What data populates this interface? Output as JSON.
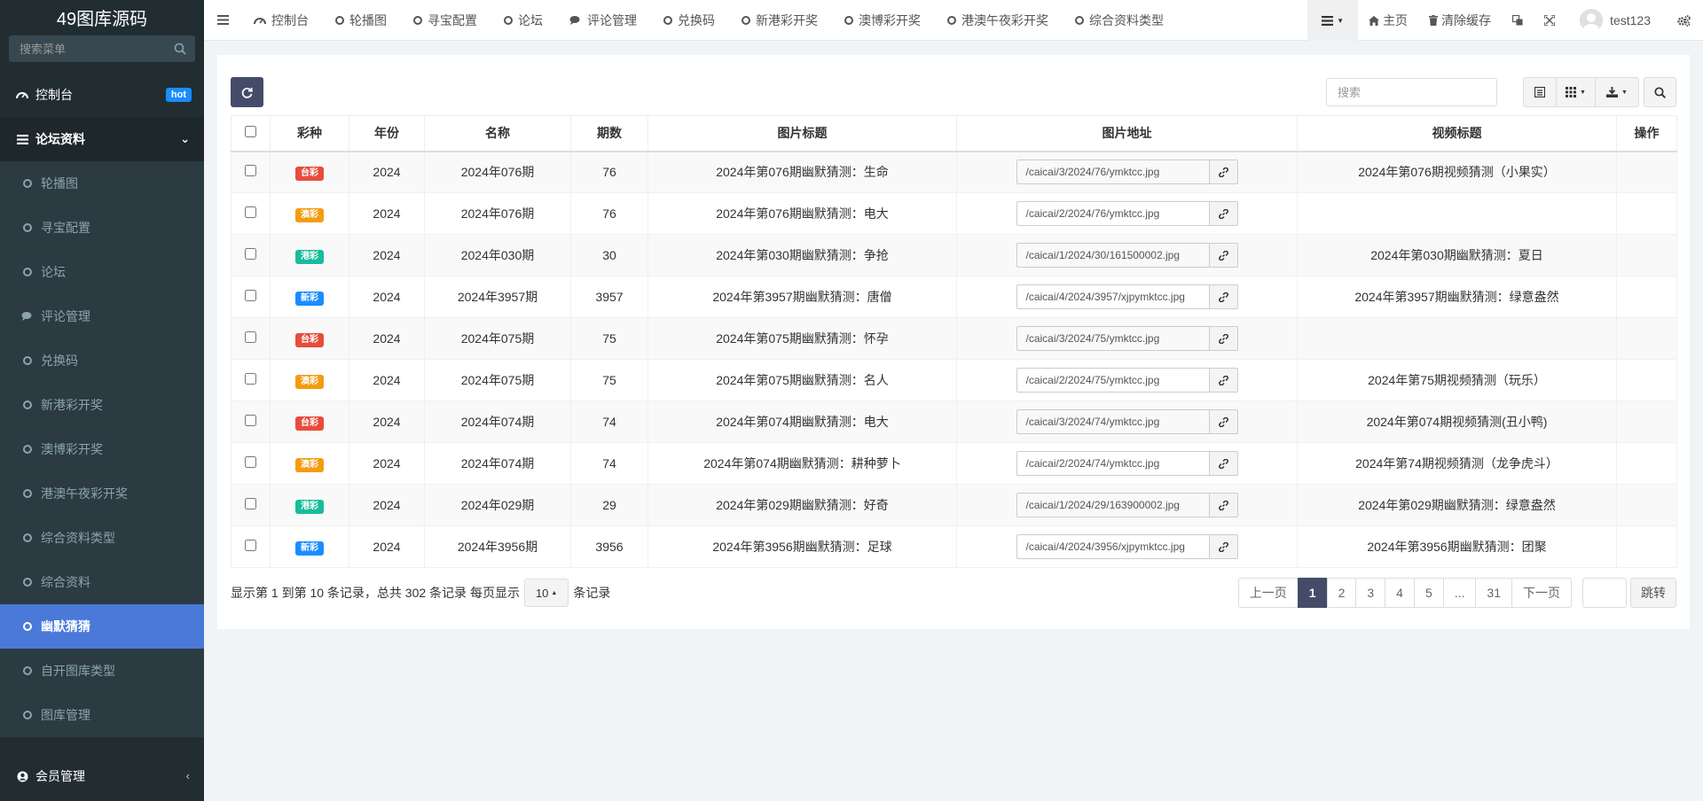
{
  "app": {
    "logo": "49图库源码"
  },
  "sidebar": {
    "search_placeholder": "搜索菜单",
    "dashboard": {
      "label": "控制台",
      "badge": "hot"
    },
    "group": {
      "label": "论坛资料"
    },
    "items": [
      {
        "label": "轮播图"
      },
      {
        "label": "寻宝配置"
      },
      {
        "label": "论坛"
      },
      {
        "label": "评论管理"
      },
      {
        "label": "兑换码"
      },
      {
        "label": "新港彩开奖"
      },
      {
        "label": "澳博彩开奖"
      },
      {
        "label": "港澳午夜彩开奖"
      },
      {
        "label": "综合资料类型"
      },
      {
        "label": "综合资料"
      },
      {
        "label": "幽默猜猜"
      },
      {
        "label": "自开图库类型"
      },
      {
        "label": "图库管理"
      }
    ],
    "member": {
      "label": "会员管理"
    }
  },
  "topbar": {
    "tabs": [
      {
        "label": "控制台",
        "icon": "dashboard-icon"
      },
      {
        "label": "轮播图",
        "icon": "circle-icon"
      },
      {
        "label": "寻宝配置",
        "icon": "circle-icon"
      },
      {
        "label": "论坛",
        "icon": "circle-icon"
      },
      {
        "label": "评论管理",
        "icon": "comments-icon"
      },
      {
        "label": "兑换码",
        "icon": "circle-icon"
      },
      {
        "label": "新港彩开奖",
        "icon": "circle-icon"
      },
      {
        "label": "澳博彩开奖",
        "icon": "circle-icon"
      },
      {
        "label": "港澳午夜彩开奖",
        "icon": "circle-icon"
      },
      {
        "label": "综合资料类型",
        "icon": "circle-icon"
      }
    ],
    "home": "主页",
    "clear_cache": "清除缓存",
    "username": "test123"
  },
  "toolbar": {
    "search_placeholder": "搜索"
  },
  "table": {
    "headers": [
      "彩种",
      "年份",
      "名称",
      "期数",
      "图片标题",
      "图片地址",
      "视频标题",
      "操作"
    ],
    "lottery_colors": {
      "台彩": "#e74c3c",
      "澳彩": "#f39c12",
      "港彩": "#18bc9c",
      "新彩": "#1a8cff"
    },
    "rows": [
      {
        "tag": "台彩",
        "year": "2024",
        "name": "2024年076期",
        "issue": "76",
        "img_title": "2024年第076期幽默猜测：生命",
        "img_url": "/caicai/3/2024/76/ymktcc.jpg",
        "video_title": "2024年第076期视频猜测（小果实）"
      },
      {
        "tag": "澳彩",
        "year": "2024",
        "name": "2024年076期",
        "issue": "76",
        "img_title": "2024年第076期幽默猜测：电大",
        "img_url": "/caicai/2/2024/76/ymktcc.jpg",
        "video_title": ""
      },
      {
        "tag": "港彩",
        "year": "2024",
        "name": "2024年030期",
        "issue": "30",
        "img_title": "2024年第030期幽默猜测：争抢",
        "img_url": "/caicai/1/2024/30/161500002.jpg",
        "video_title": "2024年第030期幽默猜测：夏日"
      },
      {
        "tag": "新彩",
        "year": "2024",
        "name": "2024年3957期",
        "issue": "3957",
        "img_title": "2024年第3957期幽默猜测：唐僧",
        "img_url": "/caicai/4/2024/3957/xjpymktcc.jpg",
        "video_title": "2024年第3957期幽默猜测：绿意盎然"
      },
      {
        "tag": "台彩",
        "year": "2024",
        "name": "2024年075期",
        "issue": "75",
        "img_title": "2024年第075期幽默猜测：怀孕",
        "img_url": "/caicai/3/2024/75/ymktcc.jpg",
        "video_title": ""
      },
      {
        "tag": "澳彩",
        "year": "2024",
        "name": "2024年075期",
        "issue": "75",
        "img_title": "2024年第075期幽默猜测：名人",
        "img_url": "/caicai/2/2024/75/ymktcc.jpg",
        "video_title": "2024年第75期视频猜测（玩乐）"
      },
      {
        "tag": "台彩",
        "year": "2024",
        "name": "2024年074期",
        "issue": "74",
        "img_title": "2024年第074期幽默猜测：电大",
        "img_url": "/caicai/3/2024/74/ymktcc.jpg",
        "video_title": "2024年第074期视频猜测(丑小鸭)"
      },
      {
        "tag": "澳彩",
        "year": "2024",
        "name": "2024年074期",
        "issue": "74",
        "img_title": "2024年第074期幽默猜测：耕种萝卜",
        "img_url": "/caicai/2/2024/74/ymktcc.jpg",
        "video_title": "2024年第74期视频猜测（龙争虎斗）"
      },
      {
        "tag": "港彩",
        "year": "2024",
        "name": "2024年029期",
        "issue": "29",
        "img_title": "2024年第029期幽默猜测：好奇",
        "img_url": "/caicai/1/2024/29/163900002.jpg",
        "video_title": "2024年第029期幽默猜测：绿意盎然"
      },
      {
        "tag": "新彩",
        "year": "2024",
        "name": "2024年3956期",
        "issue": "3956",
        "img_title": "2024年第3956期幽默猜测：足球",
        "img_url": "/caicai/4/2024/3956/xjpymktcc.jpg",
        "video_title": "2024年第3956期幽默猜测：团聚"
      }
    ]
  },
  "footer": {
    "summary": "显示第 1 到第 10 条记录，总共 302 条记录 每页显示",
    "page_size": "10",
    "suffix": "条记录"
  },
  "pagination": {
    "prev": "上一页",
    "pages": [
      "1",
      "2",
      "3",
      "4",
      "5",
      "...",
      "31"
    ],
    "current": "1",
    "next": "下一页",
    "jump": "跳转"
  }
}
